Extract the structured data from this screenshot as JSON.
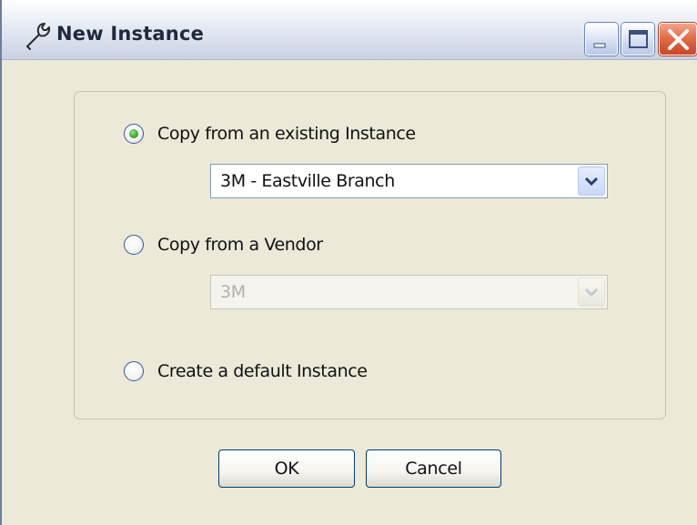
{
  "window": {
    "title": "New Instance",
    "icon": "wrench-icon",
    "controls": {
      "minimize": "minimize-icon",
      "maximize": "maximize-icon",
      "close": "close-icon"
    }
  },
  "options": {
    "copy_existing": {
      "label": "Copy from an existing Instance",
      "checked": true,
      "select_value": "3M - Eastville Branch",
      "enabled": true
    },
    "copy_vendor": {
      "label": "Copy from a Vendor",
      "checked": false,
      "select_value": "3M",
      "enabled": false
    },
    "create_default": {
      "label": "Create a default Instance",
      "checked": false
    }
  },
  "buttons": {
    "ok": "OK",
    "cancel": "Cancel"
  },
  "colors": {
    "radio_selected": "#3aa62a",
    "close_button": "#e26e48",
    "dialog_bg": "#ece9d8"
  }
}
